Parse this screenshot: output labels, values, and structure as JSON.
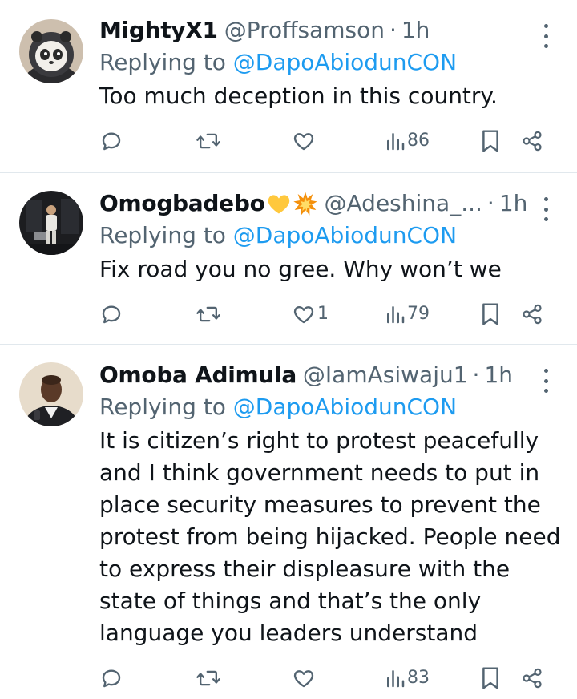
{
  "replies": [
    {
      "name": "MightyX1",
      "emoji": [],
      "handle": "@Proffsamson",
      "separator": "·",
      "time": "1h",
      "replying_prefix": "Replying to ",
      "replying_to": "@DapoAbiodunCON",
      "text": "Too much deception in this country.",
      "stats": {
        "replies": "",
        "retweets": "",
        "likes": "",
        "views": "86"
      },
      "avatar": "panda-hoodie-avatar"
    },
    {
      "name": "Omogbadebo",
      "emoji": [
        "yellow-heart",
        "collision"
      ],
      "handle": "@Adeshina_...",
      "separator": "·",
      "time": "1h",
      "replying_prefix": "Replying to ",
      "replying_to": "@DapoAbiodunCON",
      "text": "Fix road you no gree. Why won’t we",
      "stats": {
        "replies": "",
        "retweets": "",
        "likes": "1",
        "views": "79"
      },
      "avatar": "person-standing-dark-avatar"
    },
    {
      "name": "Omoba Adimula",
      "emoji": [],
      "handle": "@IamAsiwaju1",
      "separator": "·",
      "time": "1h",
      "replying_prefix": "Replying to ",
      "replying_to": "@DapoAbiodunCON",
      "text_lines": [
        "It is citizen’s right to protest peacefully",
        "and I think government needs to put in",
        "place security measures to prevent the",
        "protest from being hijacked. People need",
        "to express their displeasure with the",
        "state of things and that’s the only",
        "language you leaders understand"
      ],
      "stats": {
        "replies": "",
        "retweets": "",
        "likes": "",
        "views": "83"
      },
      "avatar": "man-in-suit-avatar"
    }
  ],
  "colors": {
    "text": "#0f1419",
    "muted": "#536471",
    "link": "#1d9bf0",
    "divider": "#e1e8ed"
  }
}
